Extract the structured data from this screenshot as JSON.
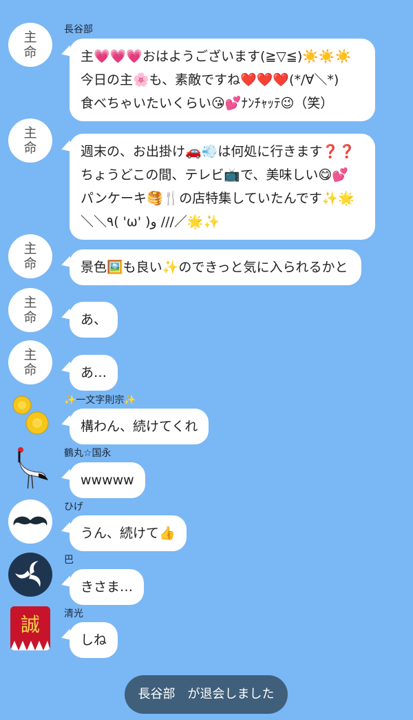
{
  "messages": [
    {
      "sender": "長谷部",
      "avatar_text": [
        "主",
        "命"
      ],
      "lines": [
        "主💗💗💗おはようございます(≧▽≦)☀️☀️☀️",
        "今日の主🌸も、素敵ですね❤️❤️❤️(*/∀＼*)",
        "食べちゃいたいくらい😘💕ﾅﾝﾁｬｯﾃ😉（笑）"
      ]
    },
    {
      "sender": "",
      "avatar_text": [
        "主",
        "命"
      ],
      "lines": [
        "週末の、お出掛け🚗💨は何処に行きます❓❓",
        "ちょうどこの間、テレビ📺で、美味しい😋💕",
        "パンケーキ🥞🍴の店特集していたんです✨🌟",
        "＼＼٩( 'ω' )و ///／🌟✨"
      ]
    },
    {
      "sender": "",
      "avatar_text": [
        "主",
        "命"
      ],
      "lines": [
        "景色🖼️も良い✨のできっと気に入られるかと"
      ]
    },
    {
      "sender": "",
      "avatar_text": [
        "主",
        "命"
      ],
      "lines": [
        "あ、"
      ]
    },
    {
      "sender": "",
      "avatar_text": [
        "主",
        "命"
      ],
      "lines": [
        "あ…"
      ]
    },
    {
      "sender": "✨一文字則宗✨",
      "avatar_icon": "chrysanthemum-icon",
      "lines": [
        "構わん、続けてくれ"
      ]
    },
    {
      "sender": "鶴丸☆国永",
      "avatar_icon": "crane-icon",
      "lines": [
        "wwwww"
      ]
    },
    {
      "sender": "ひげ",
      "avatar_icon": "mustache-icon",
      "lines": [
        "うん、続けて👍"
      ]
    },
    {
      "sender": "巴",
      "avatar_icon": "tomoe-crest-icon",
      "lines": [
        "きさま…"
      ]
    },
    {
      "sender": "清光",
      "avatar_icon": "makoto-crest-icon",
      "avatar_text_glyph": "誠",
      "lines": [
        "しね"
      ]
    }
  ],
  "system_message": "長谷部　が退会しました",
  "colors": {
    "background": "#7ab7f5",
    "bubble": "#ffffff",
    "system_pill": "#3f5f7a"
  }
}
